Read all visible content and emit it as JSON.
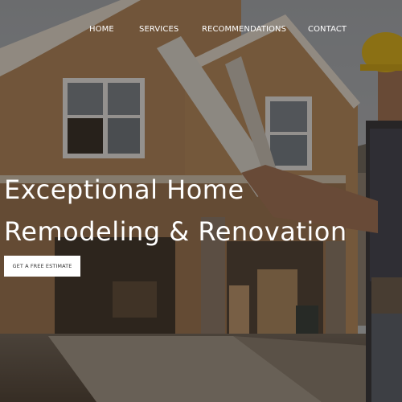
{
  "nav": {
    "items": [
      {
        "label": "HOME"
      },
      {
        "label": "SERVICES"
      },
      {
        "label": "RECOMMENDATIONS"
      },
      {
        "label": "CONTACT"
      }
    ]
  },
  "hero": {
    "headline_line1": "Exceptional Home",
    "headline_line2": "Remodeling & Renovation",
    "cta_label": "GET A FREE ESTIMATE",
    "background_description_icon": "house-under-construction-photo"
  },
  "colors": {
    "text": "#ffffff",
    "cta_bg": "#ffffff",
    "cta_text": "#333333",
    "overlay": "#2a231c"
  }
}
